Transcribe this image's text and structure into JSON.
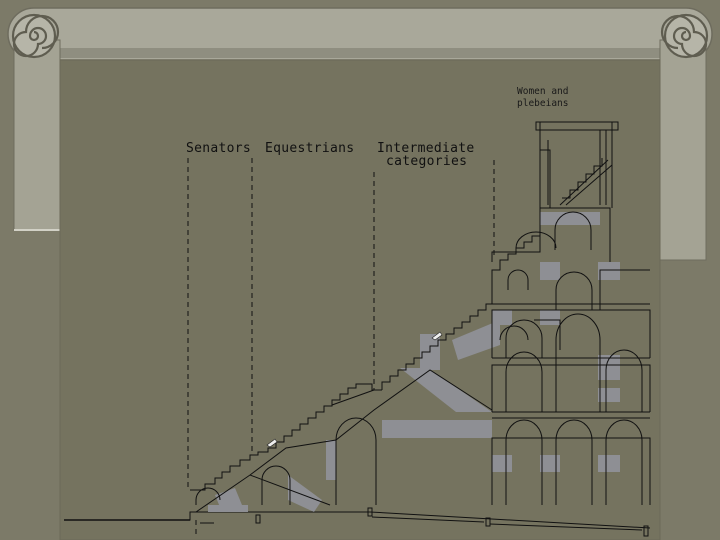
{
  "labels": {
    "senators": "Senators",
    "equestrians": "Equestrians",
    "intermediate_1": "Intermediate",
    "intermediate_2": "categories",
    "women_1": "Women and",
    "women_2": "plebeians"
  },
  "colors": {
    "background": "#7c7a68",
    "frame": "#a9a89a",
    "frame_shadow": "#5e5c4e",
    "drawing_panel": "#75735f",
    "line": "#111111",
    "fill_gray": "#8e8f94"
  },
  "icons": [
    "scroll-volute-left-icon",
    "scroll-volute-right-icon"
  ]
}
